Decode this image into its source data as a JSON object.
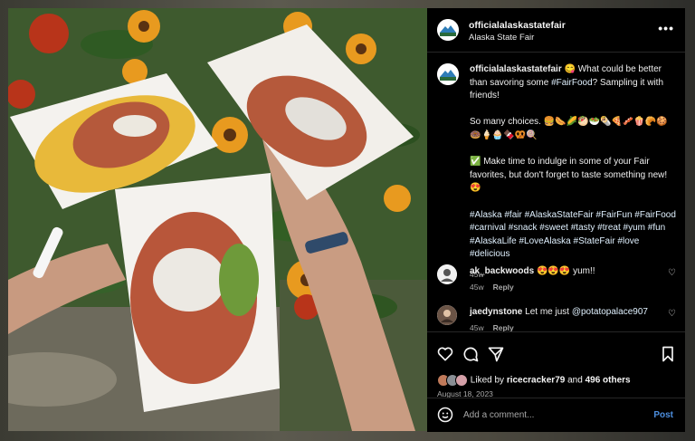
{
  "colors": {
    "background": "#000000",
    "link": "#e0f1ff",
    "post_button": "#4d8fe0",
    "muted": "#a8a8a8"
  },
  "photo": {
    "alt_icon": "food-photo"
  },
  "header": {
    "username": "officialalaskastatefair",
    "subtitle": "Alaska State Fair",
    "more_icon": "more-icon"
  },
  "caption": {
    "username": "officialalaskastatefair",
    "line1": "😋 What could be better than savoring some ",
    "line1_tag": "#FairFood",
    "line1_end": "? Sampling it with friends!",
    "line2": "So many choices. 🍔🌭🌽🥙🥗🌯🍕🥓🍿🥐🍪🍩🍦🧁🍫🥨🍭",
    "line3": "✅ Make time to indulge in some of your Fair favorites, but don't forget to taste something new! 😍",
    "hashtags": "#Alaska #fair #AlaskaStateFair #FairFun #FairFood #carnival #snack #sweet #tasty #treat #yum #fun #AlaskaLife #LoveAlaska #StateFair #love #delicious",
    "age": "45w"
  },
  "comments": [
    {
      "username": "ak_backwoods",
      "text": "😍😍😍 yum!!",
      "age": "45w",
      "reply": "Reply"
    },
    {
      "username": "jaedynstone",
      "text": "Let me just ",
      "mention": "@potatopalace907",
      "age": "45w",
      "reply": "Reply"
    }
  ],
  "actions": {
    "liked_by_prefix": "Liked by ",
    "liked_by_user": "ricecracker79",
    "liked_by_mid": " and ",
    "liked_by_count": "496 others",
    "date": "August 18, 2023"
  },
  "add_comment": {
    "placeholder": "Add a comment...",
    "post_label": "Post"
  }
}
